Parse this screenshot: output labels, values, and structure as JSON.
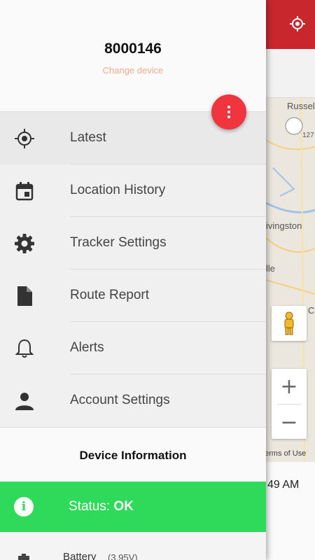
{
  "header": {
    "device_id": "8000146",
    "change_device": "Change device"
  },
  "menu": {
    "items": [
      {
        "label": "Latest",
        "icon": "crosshair-target-icon"
      },
      {
        "label": "Location History",
        "icon": "calendar-icon"
      },
      {
        "label": "Tracker Settings",
        "icon": "gear-icon"
      },
      {
        "label": "Route Report",
        "icon": "document-icon"
      },
      {
        "label": "Alerts",
        "icon": "bell-icon"
      },
      {
        "label": "Account Settings",
        "icon": "person-icon"
      }
    ]
  },
  "device_info": {
    "title": "Device Information",
    "status_prefix": "Status: ",
    "status_value": "OK",
    "battery_label": "Battery",
    "battery_voltage": "(3.95V)"
  },
  "background": {
    "map_labels": [
      "Russel",
      "ivingston",
      "lle",
      "C"
    ],
    "route_shield": "127",
    "terms": "erms of Use",
    "time": "49 AM",
    "zoom_in": "+",
    "zoom_out": "−"
  },
  "colors": {
    "topbar": "#c8272e",
    "fab": "#f0353f",
    "status_ok": "#2fd95a",
    "change_device": "#f2a98f"
  }
}
